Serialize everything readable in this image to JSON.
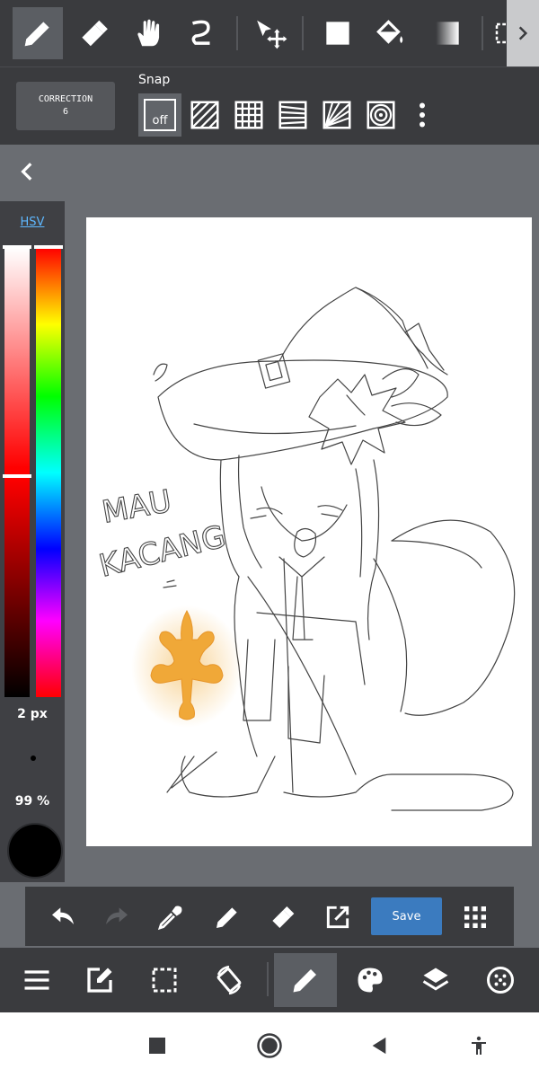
{
  "top_toolbar": {
    "tools": [
      {
        "name": "pen-tool",
        "icon": "pen-icon",
        "active": true
      },
      {
        "name": "eraser-tool",
        "icon": "eraser-icon",
        "active": false
      },
      {
        "name": "hand-tool",
        "icon": "hand-icon",
        "active": false
      },
      {
        "name": "lasso-tool",
        "icon": "lasso-icon",
        "active": false
      },
      {
        "name": "move-tool",
        "icon": "move-icon",
        "active": false
      },
      {
        "name": "fill-rect-tool",
        "icon": "square-icon",
        "active": false
      },
      {
        "name": "bucket-tool",
        "icon": "bucket-icon",
        "active": false
      },
      {
        "name": "gradient-tool",
        "icon": "gradient-icon",
        "active": false
      },
      {
        "name": "select-tool",
        "icon": "selection-icon",
        "active": false
      }
    ],
    "more_icon": "chevron-right-icon"
  },
  "snap_bar": {
    "correction_label": "CORRECTION",
    "correction_value": "6",
    "snap_label": "Snap",
    "snap_off_label": "off",
    "snap_modes": [
      "off",
      "parallel-line",
      "grid",
      "perspective",
      "radial",
      "concentric"
    ]
  },
  "color_panel": {
    "mode_label": "HSV",
    "brush_size": "2 px",
    "opacity": "99 %",
    "current_color": "#000000"
  },
  "canvas": {
    "text_line_1": "MAU",
    "text_line_2": "KACANG",
    "accent_gold": "#f2b040"
  },
  "action_bar": {
    "save_label": "Save",
    "icons": [
      "undo-icon",
      "redo-icon",
      "eyedropper-icon",
      "pen-icon",
      "eraser-icon",
      "export-icon",
      "grid-menu-icon"
    ]
  },
  "main_nav": {
    "icons": [
      "menu-icon",
      "edit-icon",
      "selection-icon",
      "rotate-icon",
      "brush-icon",
      "palette-icon",
      "layers-icon",
      "materials-icon"
    ]
  },
  "system_nav": {
    "icons": [
      "recents-icon",
      "home-icon",
      "back-icon",
      "accessibility-icon"
    ]
  }
}
